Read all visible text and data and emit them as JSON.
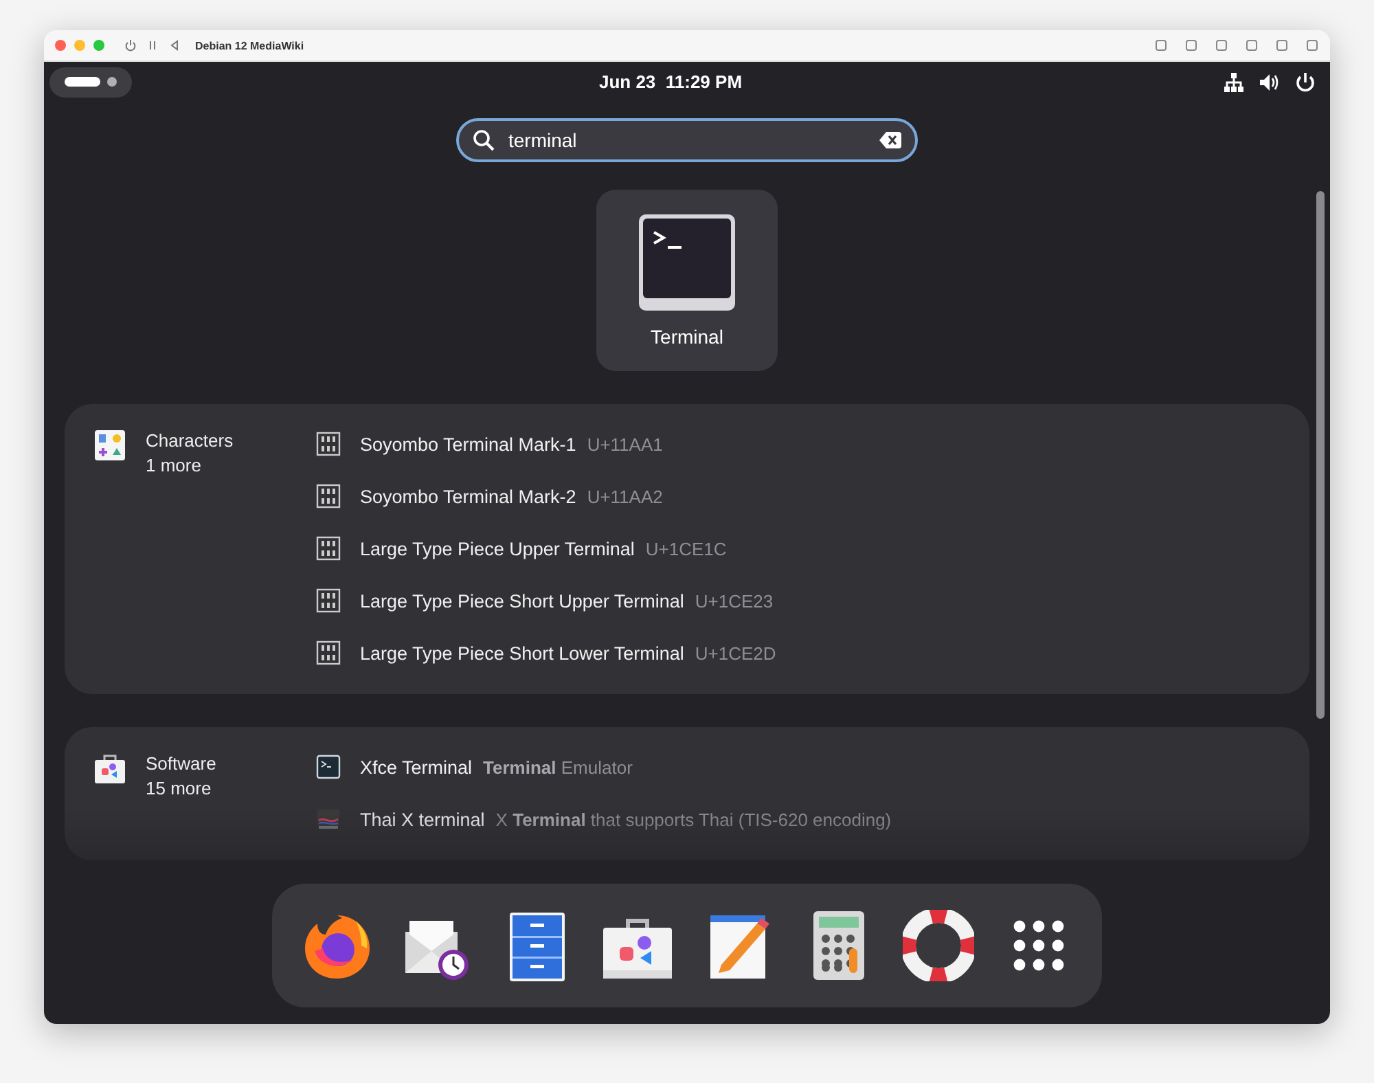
{
  "window": {
    "title": "Debian 12 MediaWiki"
  },
  "top_bar": {
    "workspaces": [
      {
        "selected": true
      },
      {
        "selected": false
      }
    ],
    "clock": "Jun 23  11:29 PM"
  },
  "search": {
    "value": "terminal"
  },
  "apps": [
    {
      "name": "Terminal"
    }
  ],
  "result_groups": [
    {
      "kind": "characters",
      "title": "Characters",
      "more": "1 more",
      "results": [
        {
          "kind": "character",
          "name": "Soyombo Terminal Mark-1",
          "detail": "U+11AA1"
        },
        {
          "kind": "character",
          "name": "Soyombo Terminal Mark-2",
          "detail": "U+11AA2"
        },
        {
          "kind": "character",
          "name": "Large Type Piece Upper Terminal",
          "detail": "U+1CE1C"
        },
        {
          "kind": "character",
          "name": "Large Type Piece Short Upper Terminal",
          "detail": "U+1CE23"
        },
        {
          "kind": "character",
          "name": "Large Type Piece Short Lower Terminal",
          "detail": "U+1CE2D"
        }
      ]
    },
    {
      "kind": "software",
      "title": "Software",
      "more": "15 more",
      "results": [
        {
          "kind": "terminal",
          "name": "Xfce Terminal",
          "detail": "**Terminal** Emulator"
        },
        {
          "kind": "thai-terminal",
          "name": "Thai X terminal",
          "detail": "X **Terminal** that supports Thai (TIS-620 encoding)"
        }
      ]
    }
  ],
  "dock": [
    {
      "kind": "browser"
    },
    {
      "kind": "mail-clock"
    },
    {
      "kind": "file-cabinet"
    },
    {
      "kind": "store"
    },
    {
      "kind": "text-editor"
    },
    {
      "kind": "calculator"
    },
    {
      "kind": "help"
    },
    {
      "kind": "app-grid"
    }
  ]
}
